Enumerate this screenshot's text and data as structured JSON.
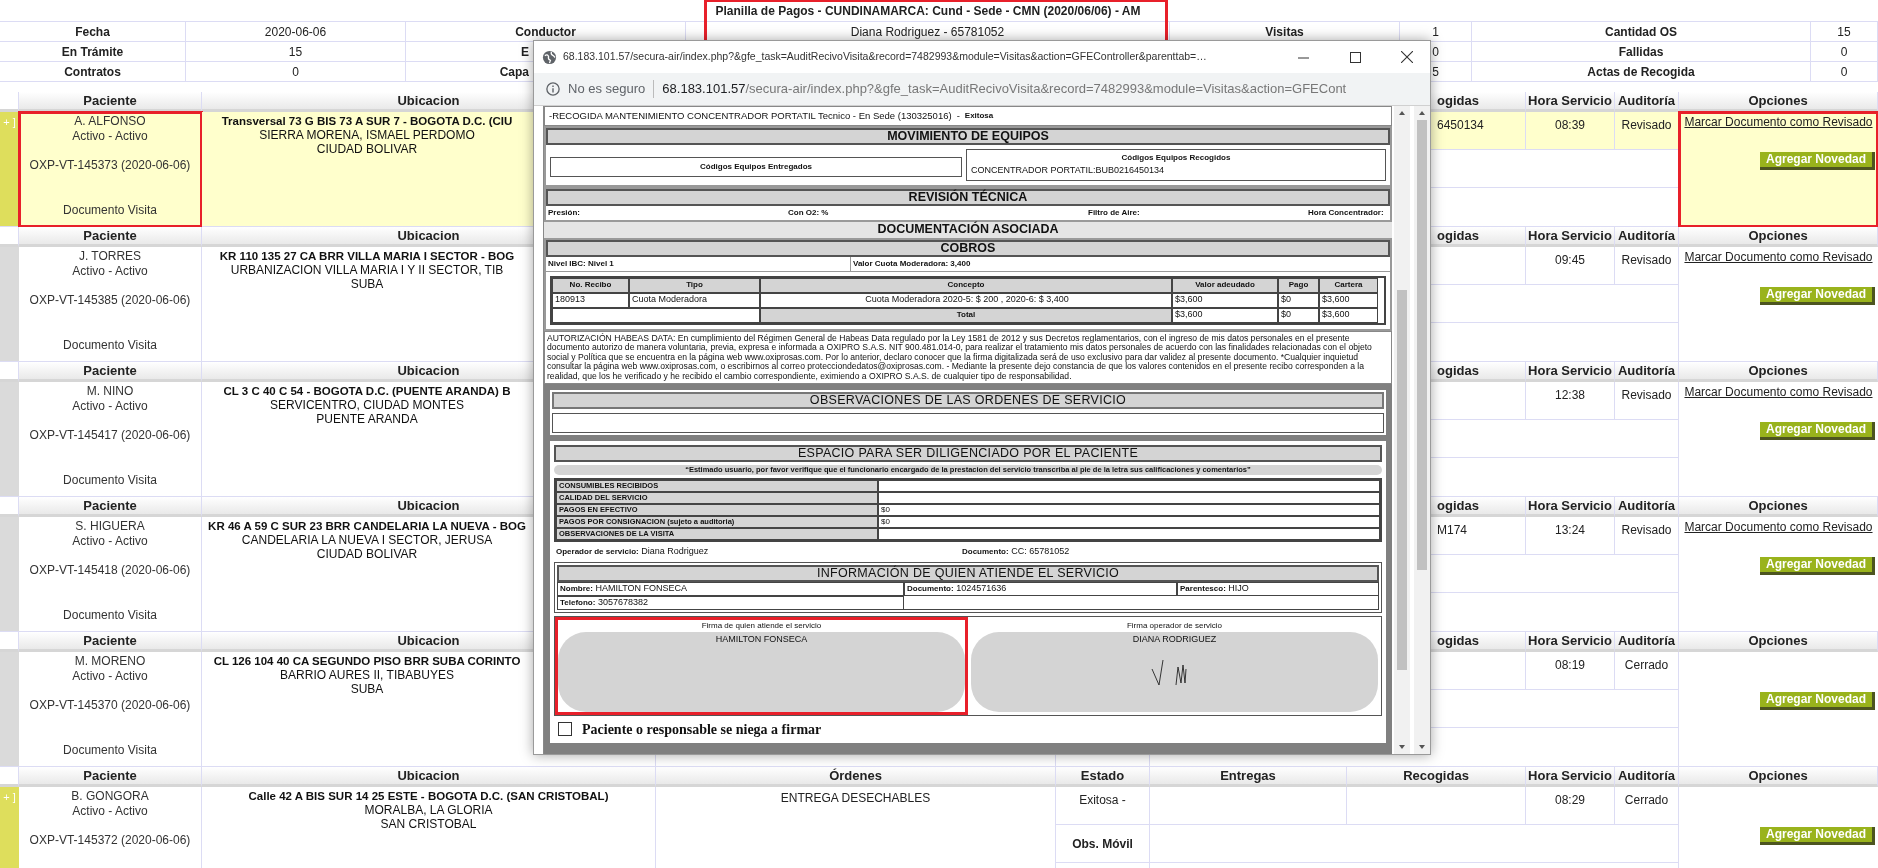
{
  "report": {
    "title": "Planilla de Pagos - CUNDINAMARCA: Cund - Sede - CMN (2020/06/06) - AM",
    "highlighted": true
  },
  "summary": [
    {
      "label_1": "Fecha",
      "value_1": "2020-06-06",
      "label_2": "Conductor",
      "value_2": "Diana Rodriguez - 65781052",
      "label_3": "Visitas",
      "value_3": "1",
      "label_4": "Cantidad OS",
      "value_4": "15"
    },
    {
      "label_1": "En Trámite",
      "value_1": "15",
      "label_2": "E",
      "value_3": "0",
      "label_4": "Fallidas",
      "value_4": "0"
    },
    {
      "label_1": "Contratos",
      "value_1": "0",
      "label_2": "Capa",
      "value_3": "5",
      "label_4": "Actas de Recogida",
      "value_4": "0"
    }
  ],
  "blocks": [
    {
      "headers": {
        "paciente": "Paciente",
        "ubicacion": "Ubicacion",
        "recogidas": "ogidas",
        "hora": "Hora Servicio",
        "auditoria": "Auditoría",
        "opciones": "Opciones"
      },
      "marker": "+ ]",
      "selected": true,
      "highlighted": true,
      "patient": {
        "name": "A. ALFONSO",
        "status": "Activo - Activo",
        "visit": "OXP-VT-145373 (2020-06-06)",
        "document": "Documento Visita"
      },
      "address": [
        "Transversal 73 G BIS 73 A SUR 7 - BOGOTA D.C. (CIU",
        "SIERRA MORENA, ISMAEL PERDOMO",
        "CIUDAD BOLIVAR"
      ],
      "recogidas": "6450134",
      "hora": "08:39",
      "auditoria": "Revisado",
      "mark_link": "Marcar Documento como Revisado",
      "button": "Agregar Novedad"
    },
    {
      "headers": {
        "paciente": "Paciente",
        "ubicacion": "Ubicacion",
        "recogidas": "ogidas",
        "hora": "Hora Servicio",
        "auditoria": "Auditoría",
        "opciones": "Opciones"
      },
      "selected": false,
      "highlighted": false,
      "patient": {
        "name": "J. TORRES",
        "status": "Activo - Activo",
        "visit": "OXP-VT-145385 (2020-06-06)",
        "document": "Documento Visita"
      },
      "address": [
        "KR 110 135 27 CA BRR VILLA MARIA I SECTOR - BOG",
        "URBANIZACION VILLA MARIA I Y II SECTOR, TIB",
        "SUBA"
      ],
      "hora": "09:45",
      "auditoria": "Revisado",
      "mark_link": "Marcar Documento como Revisado",
      "button": "Agregar Novedad"
    },
    {
      "headers": {
        "paciente": "Paciente",
        "ubicacion": "Ubicacion",
        "recogidas": "ogidas",
        "hora": "Hora Servicio",
        "auditoria": "Auditoría",
        "opciones": "Opciones"
      },
      "selected": false,
      "highlighted": false,
      "patient": {
        "name": "M. NINO",
        "status": "Activo - Activo",
        "visit": "OXP-VT-145417 (2020-06-06)",
        "document": "Documento Visita"
      },
      "address": [
        "CL 3 C 40 C 54 - BOGOTA D.C. (PUENTE ARANDA) B",
        "SERVICENTRO, CIUDAD MONTES",
        "PUENTE ARANDA"
      ],
      "hora": "12:38",
      "auditoria": "Revisado",
      "mark_link": "Marcar Documento como Revisado",
      "button": "Agregar Novedad"
    },
    {
      "headers": {
        "paciente": "Paciente",
        "ubicacion": "Ubicacion",
        "recogidas": "ogidas",
        "hora": "Hora Servicio",
        "auditoria": "Auditoría",
        "opciones": "Opciones"
      },
      "selected": false,
      "highlighted": false,
      "patient": {
        "name": "S. HIGUERA",
        "status": "Activo - Activo",
        "visit": "OXP-VT-145418 (2020-06-06)",
        "document": "Documento Visita"
      },
      "address": [
        "KR 46 A 59 C SUR 23 BRR CANDELARIA LA NUEVA - BOG",
        "CANDELARIA LA NUEVA I SECTOR, JERUSA",
        "CIUDAD BOLIVAR"
      ],
      "recogidas": "M174",
      "hora": "13:24",
      "auditoria": "Revisado",
      "mark_link": "Marcar Documento como Revisado",
      "button": "Agregar Novedad"
    },
    {
      "headers": {
        "paciente": "Paciente",
        "ubicacion": "Ubicacion",
        "recogidas": "ogidas",
        "hora": "Hora Servicio",
        "auditoria": "Auditoría",
        "opciones": "Opciones"
      },
      "selected": false,
      "highlighted": false,
      "patient": {
        "name": "M. MORENO",
        "status": "Activo - Activo",
        "visit": "OXP-VT-145370 (2020-06-06)",
        "document": "Documento Visita"
      },
      "address": [
        "CL 126 104 40 CA SEGUNDO PISO BRR SUBA CORINTO",
        "BARRIO AURES II, TIBABUYES",
        "SUBA"
      ],
      "hora": "08:19",
      "auditoria": "Cerrado",
      "button": "Agregar Novedad"
    },
    {
      "headers": {
        "paciente": "Paciente",
        "ubicacion": "Ubicacion",
        "ordenes": "Órdenes",
        "estado": "Estado",
        "entregas": "Entregas",
        "recogidas": "Recogidas",
        "hora": "Hora Servicio",
        "auditoria": "Auditoría",
        "opciones": "Opciones"
      },
      "marker": "+ ]",
      "selected": false,
      "highlighted": false,
      "patient": {
        "name": "B. GONGORA",
        "status": "Activo - Activo",
        "visit": "OXP-VT-145372 (2020-06-06)"
      },
      "address": [
        "Calle 42 A BIS SUR 14 25 ESTE - BOGOTA D.C. (SAN CRISTOBAL)",
        "MORALBA, LA GLORIA",
        "SAN CRISTOBAL"
      ],
      "orders": "ENTREGA DESECHABLES",
      "estado": "Exitosa -",
      "obs_label": "Obs. Móvil",
      "hora": "08:29",
      "auditoria": "Cerrado",
      "button": "Agregar Novedad"
    }
  ],
  "popup": {
    "title_url": "68.183.101.57/secura-air/index.php?&gfe_task=AuditRecivoVisita&record=7482993&module=Visitas&action=GFEController&parenttab=…",
    "security": "No es seguro",
    "host": "68.183.101.57",
    "path": "/secura-air/index.php?&gfe_task=AuditRecivoVisita&record=7482993&module=Visitas&action=GFECont",
    "heading": "-RECOGIDA MANTENIMIENTO CONCENTRADOR PORTATIL Tecnico - En Sede (130325016)",
    "heading_separator": "-",
    "heading_status": "Exitosa",
    "movement": {
      "title": "MOVIMIENTO DE EQUIPOS",
      "delivered": "Códigos Equipos Entregados",
      "collected": "Códigos Equipos Recogidos",
      "collected_value": "CONCENTRADOR PORTATIL:BUB0216450134"
    },
    "review": {
      "title": "REVISIÓN TÉCNICA",
      "fields": [
        "Presión:",
        "Con O2: %",
        "Filtro de Aire:",
        "Hora Concentrador:"
      ]
    },
    "documentation": "DOCUMENTACIÓN ASOCIADA",
    "charges": {
      "title": "COBROS",
      "fields": [
        "Nivel IBC: Nivel 1",
        "Valor Cuota Moderadora: 3,400"
      ],
      "columns": [
        "No. Recibo",
        "Tipo",
        "Concepto",
        "Valor adeudado",
        "Pago",
        "Cartera"
      ],
      "rows": [
        [
          "180913",
          "Cuota Moderadora",
          "Cuota Moderadora 2020-5: $ 200 , 2020-6: $ 3,400",
          "$3,600",
          "$0",
          "$3,600"
        ]
      ],
      "total": {
        "label": "Total",
        "values": [
          "$3,600",
          "$0",
          "$3,600"
        ]
      }
    },
    "authorization": "AUTORIZACIÓN HABEAS DATA: En cumplimiento del Régimen General de Habeas Data regulado por la Ley 1581 de 2012 y sus Decretos reglamentarios, con el ingreso de mis datos personales en el presente documento autorizo de manera voluntaria, previa, expresa e informada a OXIPRO S.A.S. NIT 900.481.014-0, para realizar el tratamiento mis datos personales de acuerdo con las finalidades relacionadas con el objeto social y Política que se encuentra en la página web www.oxiprosas.com. Por lo anterior, declaro conocer que la firma digitalizada será de uso exclusivo para dar validez al presente documento. *Cualquier inquietud consultar la página web www.oxiprosas.com, o escribirnos al correo protecciondedatos@oxiprosas.com. - Mediante la presente dejo constancia de que los valores contenidos en el presente recibo corresponden a la realidad, que los he verificado y he recibido el cambio correspondiente, eximiendo a OXIPRO S.A.S. de cualquier tipo de responsabilidad.",
    "observations": "OBSERVACIONES DE LAS ORDENES DE SERVICIO",
    "patient_space": {
      "title": "ESPACIO PARA SER DILIGENCIADO POR EL PACIENTE",
      "notice": "“Estimado usuario, por favor verifique que el funcionario encargado de la prestacion del servicio transcriba al pie de la letra sus calificaciones y comentarios”",
      "rows": [
        {
          "label": "CONSUMIBLES RECIBIDOS"
        },
        {
          "label": "CALIDAD DEL SERVICIO"
        },
        {
          "label": "PAGOS EN EFECTIVO",
          "value": "$0"
        },
        {
          "label": "PAGOS POR CONSIGNACION (sujeto a auditoria)",
          "value": "$0"
        },
        {
          "label": "OBSERVACIONES DE LA VISITA"
        }
      ],
      "operator": {
        "label": "Operador de servicio:",
        "value": "Diana Rodriguez"
      },
      "operator_document": {
        "label": "Documento:",
        "value": "CC: 65781052"
      }
    },
    "attendant": {
      "title": "INFORMACIÓN DE QUIEN ATIENDE EL SERVICIO",
      "fields": [
        {
          "label": "Nombre:",
          "value": "HAMILTON FONSECA"
        },
        {
          "label": "Documento:",
          "value": "1024571636"
        },
        {
          "label": "Parentesco:",
          "value": "HIJO"
        },
        {
          "label": "Telefono:",
          "value": "3057678382"
        }
      ]
    },
    "signatures": [
      {
        "label": "Firma de quien atiende el servicio",
        "name": "HAMILTON FONSECA",
        "signed": false,
        "highlighted": true
      },
      {
        "label": "Firma operador de servicio",
        "name": "DIANA RODRIGUEZ",
        "signed": true,
        "highlighted": false
      }
    ],
    "refusal": {
      "label": "Paciente o responsable se niega a firmar",
      "checked": false
    }
  }
}
